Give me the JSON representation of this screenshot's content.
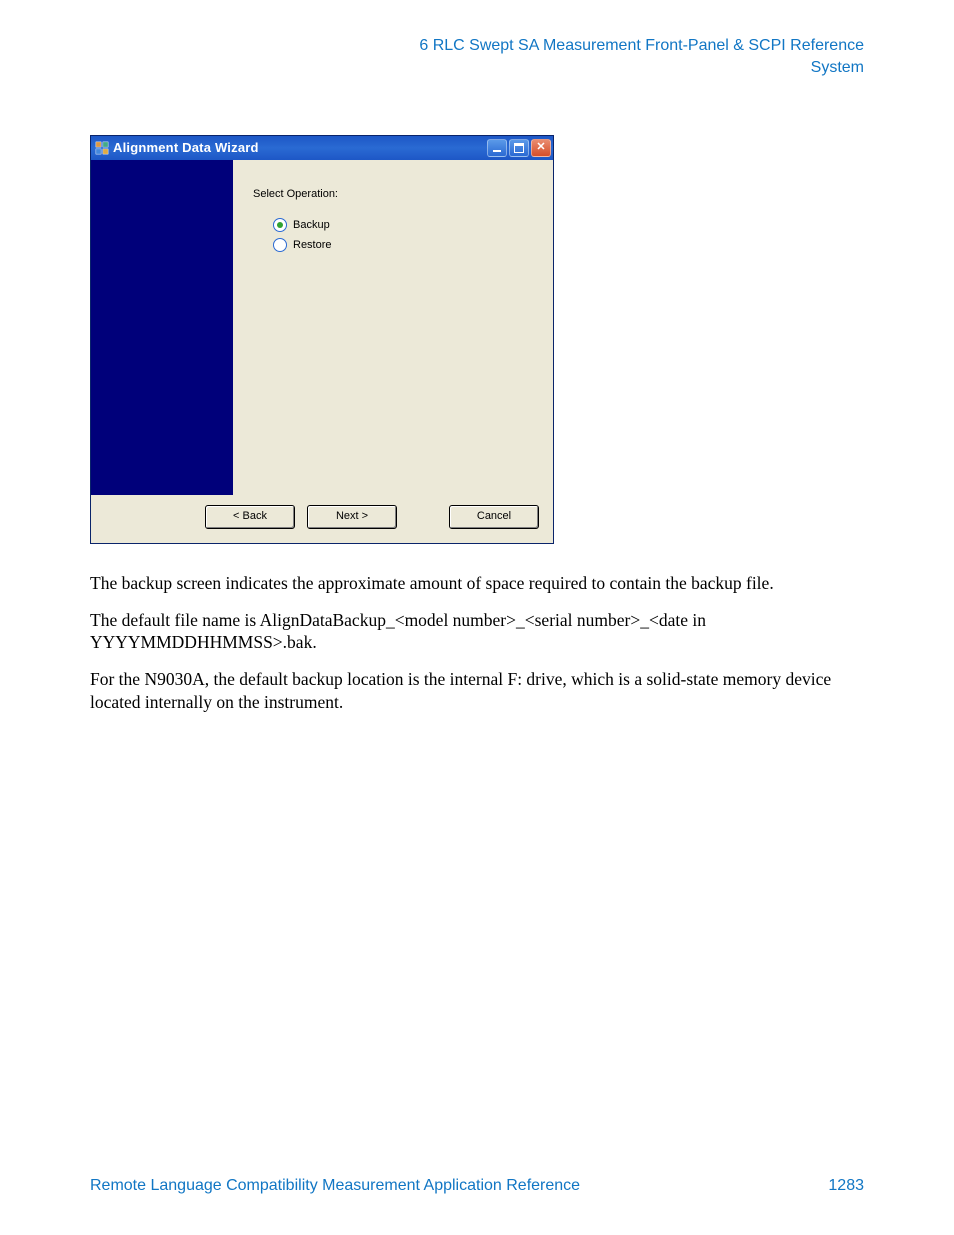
{
  "header": {
    "line1": "6  RLC Swept SA Measurement Front-Panel & SCPI Reference",
    "line2": "System"
  },
  "dialog": {
    "title": "Alignment Data Wizard",
    "select_label": "Select Operation:",
    "options": {
      "backup": "Backup",
      "restore": "Restore"
    },
    "buttons": {
      "back": "< Back",
      "next": "Next >",
      "cancel": "Cancel"
    }
  },
  "paragraphs": {
    "p1": "The backup screen indicates the approximate amount of space required to contain the backup file.",
    "p2": "The default file name is AlignDataBackup_<model number>_<serial number>_<date in YYYYMMDDHHMMSS>.bak.",
    "p3": "For the N9030A, the default backup location is the internal F: drive, which is a solid-state memory device located internally on the instrument."
  },
  "footer": {
    "left": "Remote Language Compatibility Measurement Application Reference",
    "right": "1283"
  }
}
